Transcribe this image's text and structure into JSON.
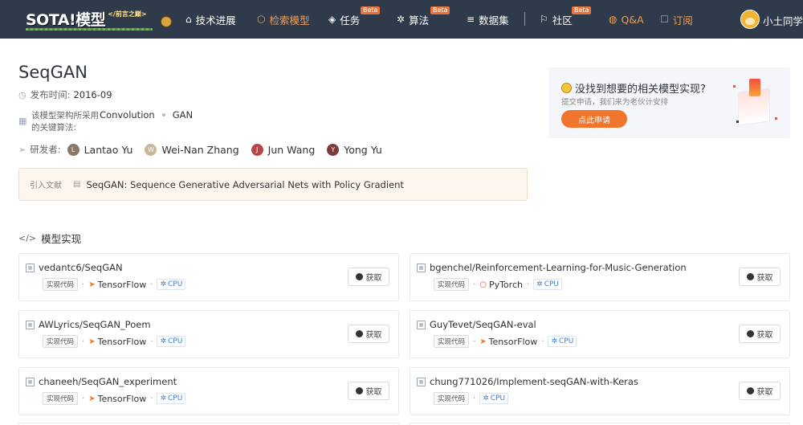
{
  "nav": {
    "logo_text": "SOTA!模型",
    "logo_tag": "</前言之巅>",
    "items": [
      {
        "label": "技术进展",
        "icon": "compass-icon",
        "glyph": "⌂"
      },
      {
        "label": "检索模型",
        "icon": "cube-icon",
        "glyph": "⬡"
      },
      {
        "label": "任务",
        "icon": "layers-icon",
        "glyph": "◈",
        "badge": "Beta"
      },
      {
        "label": "算法",
        "icon": "atom-icon",
        "glyph": "✲",
        "badge": "Beta"
      },
      {
        "label": "数据集",
        "icon": "database-icon",
        "glyph": "≡"
      },
      {
        "label": "社区",
        "icon": "flag-icon",
        "glyph": "⚐",
        "badge": "Beta"
      },
      {
        "label": "Q&A",
        "icon": "shield-icon",
        "glyph": "◍"
      },
      {
        "label": "订阅",
        "icon": "bookmark-icon",
        "glyph": "☐"
      }
    ],
    "user_name": "小土同学",
    "accent": "#f29d52"
  },
  "model": {
    "title": "SeqGAN",
    "date_label": "发布时间:",
    "date": "2016-09",
    "algo_label": "该模型架构所采用的关键算法:",
    "algos": [
      "Convolution",
      "GAN"
    ],
    "authors_label": "研发者:",
    "authors": [
      {
        "initial": "L",
        "name": "Lantao Yu",
        "color": "#8a7765"
      },
      {
        "initial": "W",
        "name": "Wei-Nan Zhang",
        "color": "#c8b79a"
      },
      {
        "initial": "J",
        "name": "Jun Wang",
        "color": "#b6484a"
      },
      {
        "initial": "Y",
        "name": "Yong Yu",
        "color": "#7c3a3a"
      }
    ],
    "cite_label": "引入文献",
    "cite_title": "SeqGAN: Sequence Generative Adversarial Nets with Policy Gradient"
  },
  "promo": {
    "title": "没找到想要的相关模型实现?",
    "subtitle": "提交申请，我们来为老伙计安排",
    "button": "点此申请"
  },
  "impl": {
    "section_title": "模型实现",
    "code_chip": "实现代码",
    "get_label": "获取",
    "cpu_label": "CPU",
    "repos": [
      {
        "name": "vedantc6/SeqGAN",
        "framework": "TensorFlow",
        "fw_icon": "tensorflow-icon"
      },
      {
        "name": "bgenchel/Reinforcement-Learning-for-Music-Generation",
        "framework": "PyTorch",
        "fw_icon": "pytorch-icon"
      },
      {
        "name": "AWLyrics/SeqGAN_Poem",
        "framework": "TensorFlow",
        "fw_icon": "tensorflow-icon"
      },
      {
        "name": "GuyTevet/SeqGAN-eval",
        "framework": "TensorFlow",
        "fw_icon": "tensorflow-icon"
      },
      {
        "name": "chaneeh/SeqGAN_experiment",
        "framework": "TensorFlow",
        "fw_icon": "tensorflow-icon"
      },
      {
        "name": "chung771026/Implement-seqGAN-with-Keras",
        "framework": "",
        "fw_icon": ""
      }
    ]
  }
}
